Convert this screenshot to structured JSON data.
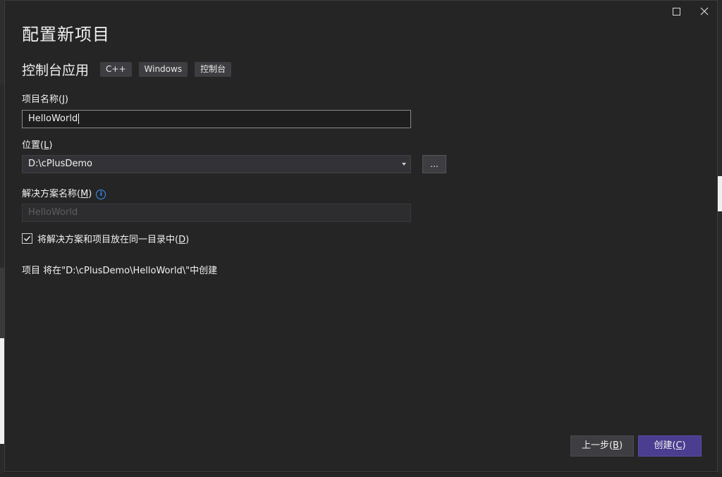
{
  "dialog": {
    "title": "配置新项目",
    "template_name": "控制台应用",
    "tags": [
      "C++",
      "Windows",
      "控制台"
    ]
  },
  "project_name": {
    "label": "项目名称(",
    "label_key": "J",
    "label_end": ")",
    "value": "HelloWorld"
  },
  "location": {
    "label": "位置(",
    "label_key": "L",
    "label_end": ")",
    "value": "D:\\cPlusDemo",
    "browse_label": "..."
  },
  "solution_name": {
    "label": "解决方案名称(",
    "label_key": "M",
    "label_end": ")",
    "placeholder": "HelloWorld",
    "info_glyph": "i"
  },
  "same_dir": {
    "label": "将解决方案和项目放在同一目录中(",
    "label_key": "D",
    "label_end": ")",
    "checked": true
  },
  "creation_path": "项目 将在\"D:\\cPlusDemo\\HelloWorld\\\"中创建",
  "buttons": {
    "back": "上一步(",
    "back_key": "B",
    "back_end": ")",
    "create": "创建(",
    "create_key": "C",
    "create_end": ")"
  },
  "icons": {
    "maximize": "maximize-icon",
    "close": "close-icon",
    "dropdown": "chevron-down-icon",
    "info": "info-icon",
    "check": "checkmark-icon"
  },
  "colors": {
    "dialog_bg": "#252526",
    "primary_button": "#4b3d8f",
    "info": "#3794ff"
  }
}
